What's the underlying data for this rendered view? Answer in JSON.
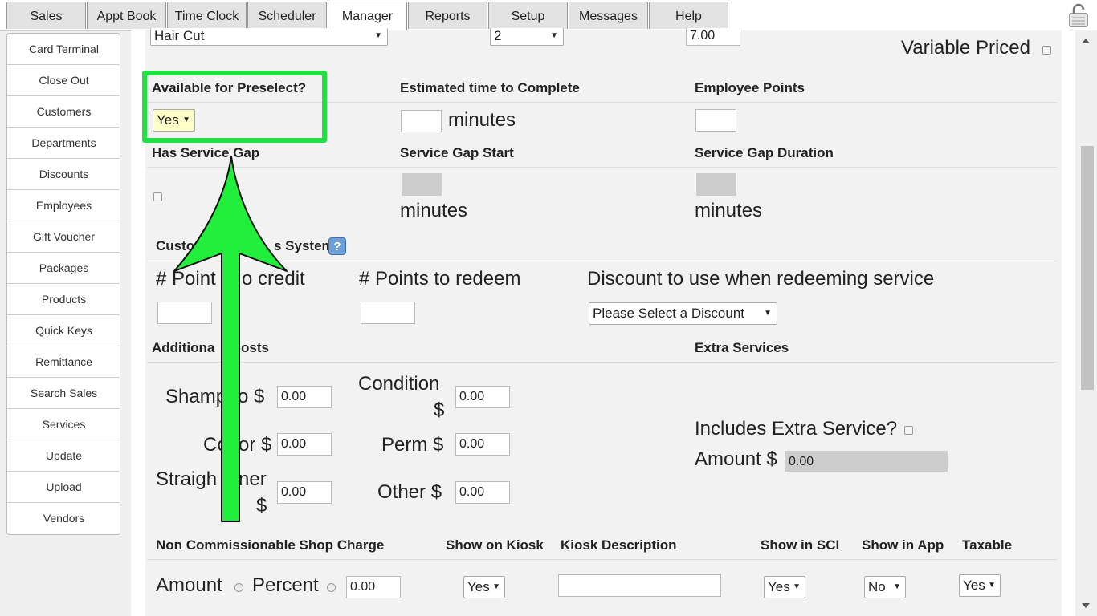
{
  "tabs": [
    "Sales",
    "Appt Book",
    "Time Clock",
    "Scheduler",
    "Manager",
    "Reports",
    "Setup",
    "Messages",
    "Help"
  ],
  "active_tab": "Manager",
  "sidebar": [
    "Card Terminal",
    "Close Out",
    "Customers",
    "Departments",
    "Discounts",
    "Employees",
    "Gift Voucher",
    "Packages",
    "Products",
    "Quick Keys",
    "Remittance",
    "Search Sales",
    "Services",
    "Update",
    "Upload",
    "Vendors"
  ],
  "form": {
    "service_select": "Hair Cut",
    "qty_select": "2",
    "price_value": "7.00",
    "variable_priced": "Variable Priced",
    "preselect_label": "Available for Preselect?",
    "preselect_value": "Yes",
    "est_time_label": "Estimated time to Complete",
    "minutes": "minutes",
    "employee_points_label": "Employee Points",
    "service_gap_label": "Has Service Gap",
    "gap_start_label": "Service Gap Start",
    "gap_duration_label": "Service Gap Duration",
    "loyalty_label_left": "Custo",
    "loyalty_label_right": "s System",
    "help_glyph": "?",
    "points_credit_left": "# Point",
    "points_credit_right": "o credit",
    "points_redeem": "# Points to redeem",
    "discount_label": "Discount to use when redeeming service",
    "discount_select": "Please Select a Discount",
    "additional_left": "Additiona",
    "additional_right": "osts",
    "extra_services": "Extra Services",
    "shampoo_left": "Shamp",
    "shampoo_right": "o $",
    "color_left": "Co",
    "color_right": "or $",
    "straight_left": "Straigh",
    "straight_right": "ner",
    "straight_dollar": "$",
    "condition": "Condition",
    "condition_dollar": "$",
    "perm": "Perm $",
    "other": "Other $",
    "zero": "0.00",
    "includes_extra": "Includes Extra Service?",
    "amount_dollar": "Amount $",
    "non_comm_label": "Non Commissionable Shop Charge",
    "show_kiosk_label": "Show on Kiosk",
    "kiosk_desc_label": "Kiosk Description",
    "show_sci_label": "Show in SCI",
    "show_app_label": "Show in App",
    "taxable_label": "Taxable",
    "amount": "Amount",
    "percent": "Percent",
    "kiosk_value": "Yes",
    "sci_value": "Yes",
    "app_value": "No",
    "taxable_value": "Yes",
    "arrow_down": "▼"
  }
}
